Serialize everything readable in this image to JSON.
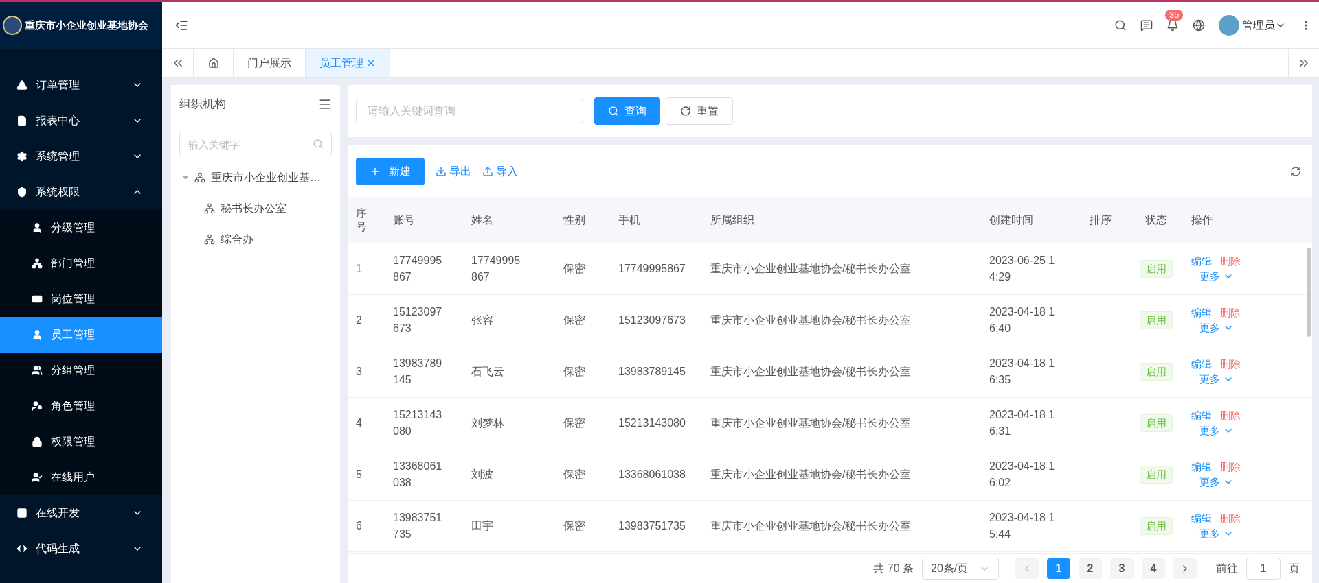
{
  "brand": {
    "title": "重庆市小企业创业基地协会"
  },
  "header": {
    "notification_count": "35",
    "user": "管理员"
  },
  "sidebar": {
    "items": [
      {
        "label": "订单管理",
        "expanded": false
      },
      {
        "label": "报表中心",
        "expanded": false
      },
      {
        "label": "系统管理",
        "expanded": false
      },
      {
        "label": "系统权限",
        "expanded": true,
        "children": [
          {
            "label": "分级管理",
            "selected": false
          },
          {
            "label": "部门管理",
            "selected": false
          },
          {
            "label": "岗位管理",
            "selected": false
          },
          {
            "label": "员工管理",
            "selected": true
          },
          {
            "label": "分组管理",
            "selected": false
          },
          {
            "label": "角色管理",
            "selected": false
          },
          {
            "label": "权限管理",
            "selected": false
          },
          {
            "label": "在线用户",
            "selected": false
          }
        ]
      },
      {
        "label": "在线开发",
        "expanded": false
      },
      {
        "label": "代码生成",
        "expanded": false
      }
    ]
  },
  "tabs": [
    {
      "kind": "home",
      "selected": false
    },
    {
      "kind": "text",
      "label": "门户展示",
      "selected": false
    },
    {
      "kind": "text",
      "label": "员工管理",
      "selected": true,
      "closable": true
    }
  ],
  "tree_panel": {
    "title": "组织机构",
    "search_placeholder": "输入关键字",
    "tree": [
      {
        "label": "重庆市小企业创业基…",
        "expanded": true,
        "children": [
          {
            "label": "秘书长办公室"
          },
          {
            "label": "综合办"
          }
        ]
      }
    ]
  },
  "search": {
    "placeholder": "请输入关键词查询",
    "query_button": "查询",
    "reset_button": "重置"
  },
  "toolbar": {
    "new_button": "新建",
    "export": "导出",
    "import": "导入"
  },
  "table": {
    "columns": [
      "序号",
      "账号",
      "姓名",
      "性别",
      "手机",
      "所属组织",
      "创建时间",
      "排序",
      "状态",
      "操作"
    ],
    "rows": [
      {
        "index": "1",
        "account": "17749995867",
        "name": "17749995867",
        "gender": "保密",
        "phone": "17749995867",
        "org": "重庆市小企业创业基地协会/秘书长办公室",
        "created": "2023-06-25 14:29",
        "status": "启用",
        "edit": "编辑",
        "delete": "删除",
        "more": "更多"
      },
      {
        "index": "2",
        "account": "15123097673",
        "name": "张容",
        "gender": "保密",
        "phone": "15123097673",
        "org": "重庆市小企业创业基地协会/秘书长办公室",
        "created": "2023-04-18 16:40",
        "status": "启用",
        "edit": "编辑",
        "delete": "删除",
        "more": "更多"
      },
      {
        "index": "3",
        "account": "13983789145",
        "name": "石飞云",
        "gender": "保密",
        "phone": "13983789145",
        "org": "重庆市小企业创业基地协会/秘书长办公室",
        "created": "2023-04-18 16:35",
        "status": "启用",
        "edit": "编辑",
        "delete": "删除",
        "more": "更多"
      },
      {
        "index": "4",
        "account": "15213143080",
        "name": "刘梦林",
        "gender": "保密",
        "phone": "15213143080",
        "org": "重庆市小企业创业基地协会/秘书长办公室",
        "created": "2023-04-18 16:31",
        "status": "启用",
        "edit": "编辑",
        "delete": "删除",
        "more": "更多"
      },
      {
        "index": "5",
        "account": "13368061038",
        "name": "刘波",
        "gender": "保密",
        "phone": "13368061038",
        "org": "重庆市小企业创业基地协会/秘书长办公室",
        "created": "2023-04-18 16:02",
        "status": "启用",
        "edit": "编辑",
        "delete": "删除",
        "more": "更多"
      },
      {
        "index": "6",
        "account": "13983751735",
        "name": "田宇",
        "gender": "保密",
        "phone": "13983751735",
        "org": "重庆市小企业创业基地协会/秘书长办公室",
        "created": "2023-04-18 15:44",
        "status": "启用",
        "edit": "编辑",
        "delete": "删除",
        "more": "更多"
      }
    ]
  },
  "pagination": {
    "total": "共 70 条",
    "page_size": "20条/页",
    "pages": [
      {
        "label": "1",
        "selected": true
      },
      {
        "label": "2",
        "selected": false
      },
      {
        "label": "3",
        "selected": false
      },
      {
        "label": "4",
        "selected": false
      }
    ],
    "goto_label": "前往",
    "goto_value": "1",
    "page_suffix": "页"
  }
}
